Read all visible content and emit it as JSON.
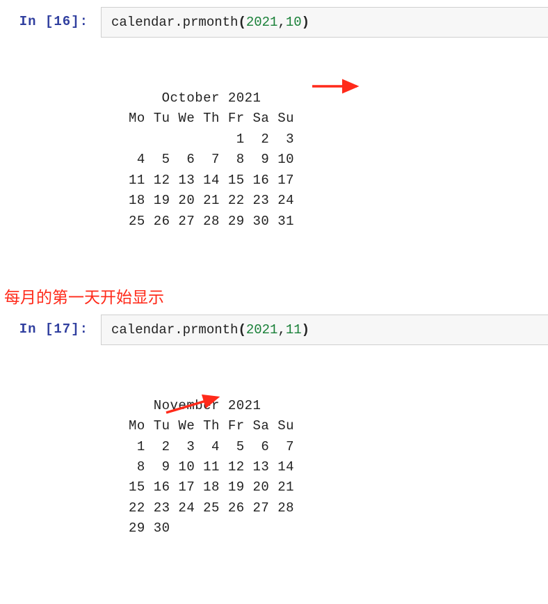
{
  "cell1": {
    "prompt": "In [16]:",
    "code_prefix": "calendar",
    "code_method": ".prmonth",
    "paren_open": "(",
    "arg1": "2021",
    "comma": ",",
    "arg2": "10",
    "paren_close": ")",
    "output_lines": [
      "    October 2021",
      "Mo Tu We Th Fr Sa Su",
      "             1  2  3",
      " 4  5  6  7  8  9 10",
      "11 12 13 14 15 16 17",
      "18 19 20 21 22 23 24",
      "25 26 27 28 29 30 31"
    ]
  },
  "annotation_text": "每月的第一天开始显示",
  "cell2": {
    "prompt": "In [17]:",
    "code_prefix": "calendar",
    "code_method": ".prmonth",
    "paren_open": "(",
    "arg1": "2021",
    "comma": ",",
    "arg2": "11",
    "paren_close": ")",
    "output_lines": [
      "   November 2021",
      "Mo Tu We Th Fr Sa Su",
      " 1  2  3  4  5  6  7",
      " 8  9 10 11 12 13 14",
      "15 16 17 18 19 20 21",
      "22 23 24 25 26 27 28",
      "29 30"
    ]
  },
  "arrow_color": "#ff2a1a"
}
